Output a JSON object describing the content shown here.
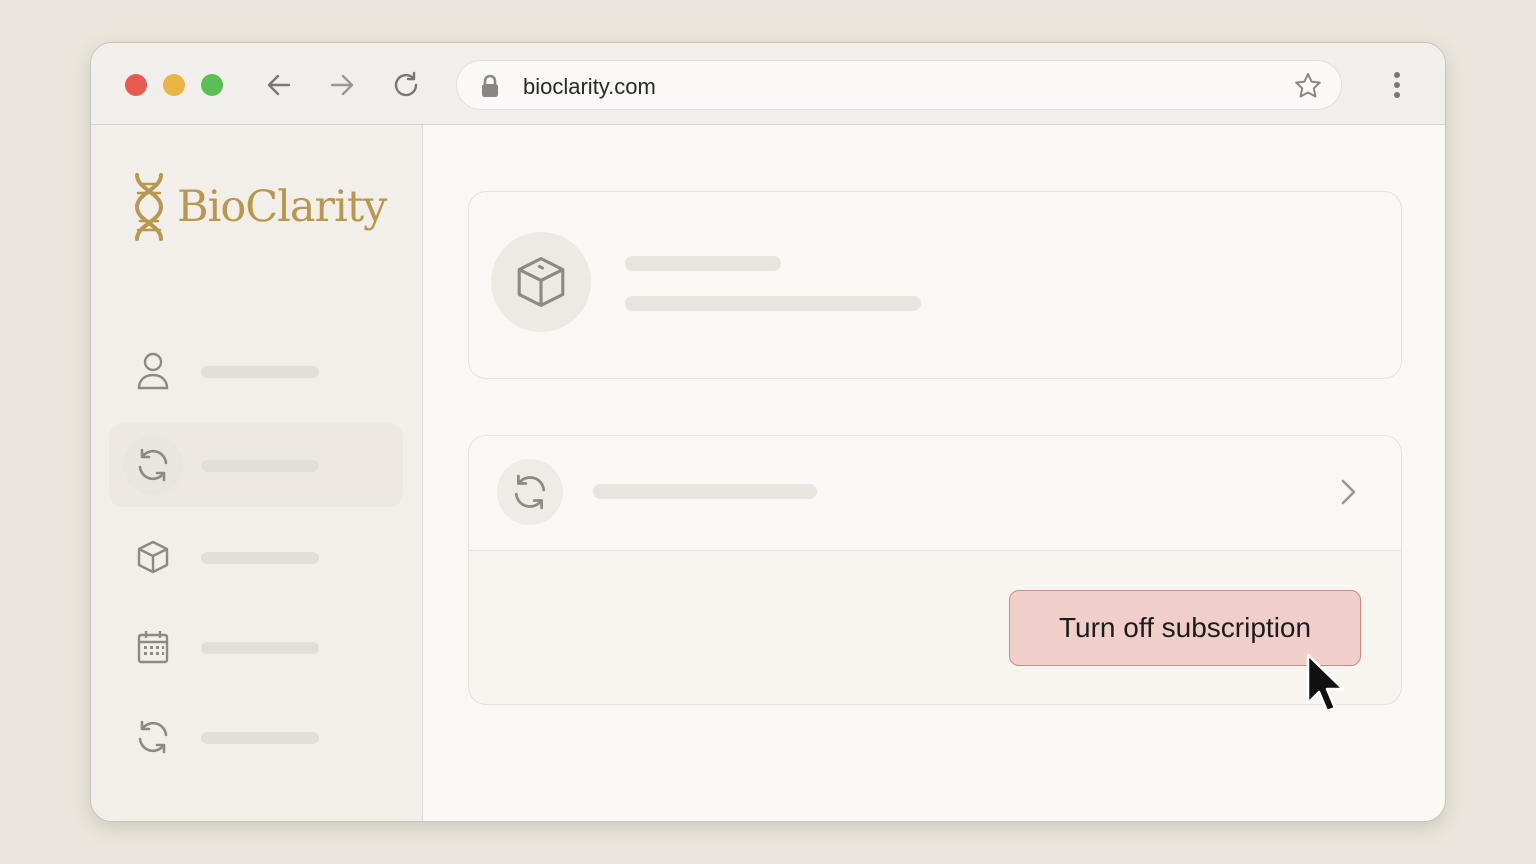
{
  "browser": {
    "url": "bioclarity.com",
    "icons": {
      "back": "arrow-left-icon",
      "forward": "arrow-right-icon",
      "reload": "reload-icon",
      "lock": "lock-icon",
      "bookmark": "star-icon",
      "menu": "kebab-menu-icon"
    }
  },
  "sidebar": {
    "logo_text": "BioClarity",
    "items": [
      {
        "icon": "user-icon",
        "active": false
      },
      {
        "icon": "refresh-icon",
        "active": true
      },
      {
        "icon": "box-icon",
        "active": false
      },
      {
        "icon": "calendar-icon",
        "active": false
      },
      {
        "icon": "refresh-icon",
        "active": false
      }
    ]
  },
  "main": {
    "product_card": {
      "icon": "box-icon"
    },
    "subscription_card": {
      "icon": "refresh-icon",
      "action_label": "Turn off subscription"
    }
  },
  "colors": {
    "brand_gold": "#b8984f",
    "danger_fill": "#f0cfcb",
    "danger_border": "#cf8a85"
  }
}
